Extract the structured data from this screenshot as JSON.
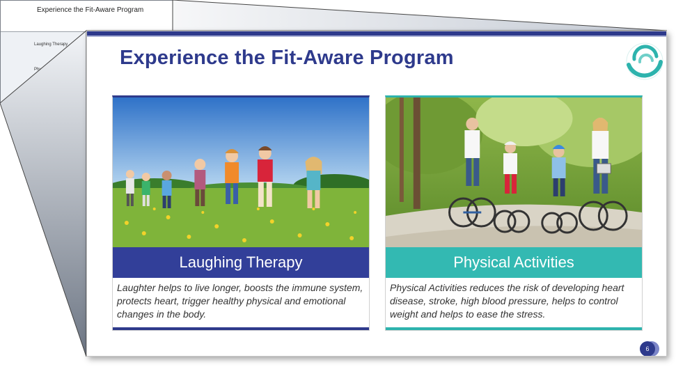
{
  "outline": {
    "title": "Experience the Fit-Aware Program",
    "rows": [
      {
        "label": "Laughing Therapy"
      },
      {
        "label": "Physical Activities"
      }
    ]
  },
  "slide": {
    "title": "Experience the Fit-Aware Program",
    "page_number": "6",
    "logo_icon": "swirl-logo-icon",
    "cards": [
      {
        "heading": "Laughing Therapy",
        "text": "Laughter helps to live longer, boosts the immune system, protects heart, trigger healthy physical and emotional changes in the body.",
        "accent": "#323f99"
      },
      {
        "heading": "Physical Activities",
        "text": "Physical Activities reduces the risk of developing heart disease, stroke, high blood pressure, helps to control weight and helps to ease the stress.",
        "accent": "#33b9b2"
      }
    ]
  },
  "colors": {
    "primary": "#2e3a8c",
    "teal": "#2db3ad"
  }
}
